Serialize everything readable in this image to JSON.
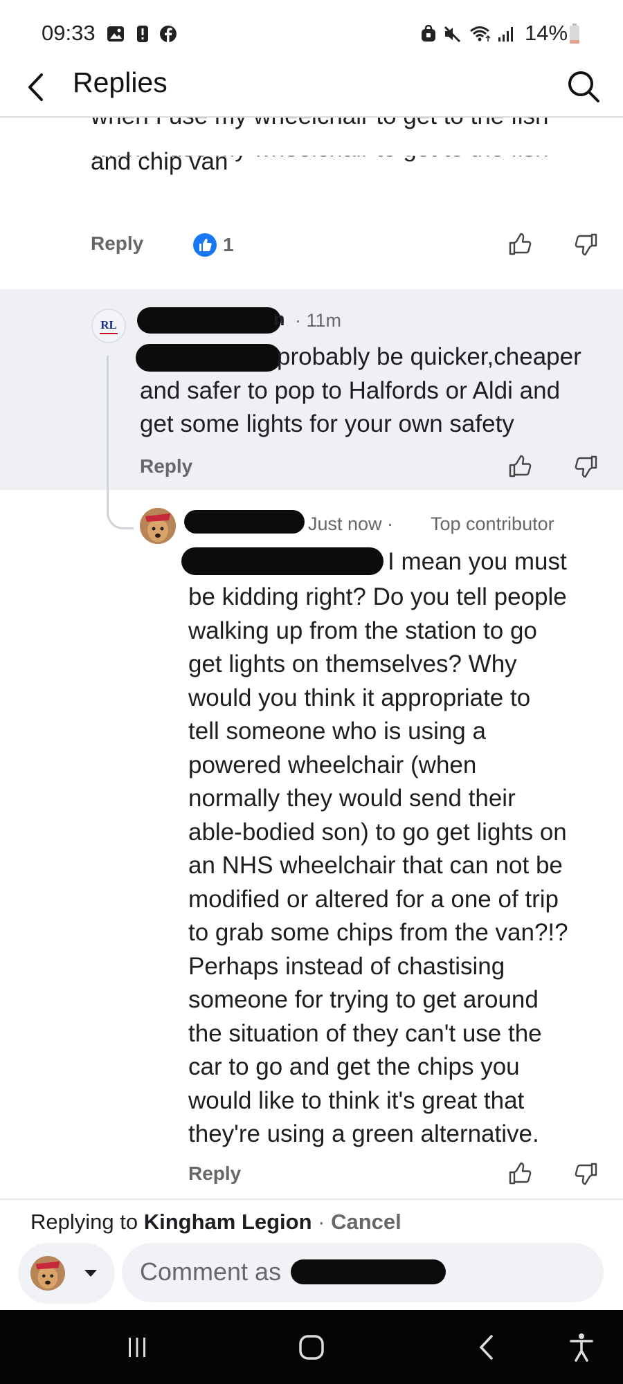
{
  "status": {
    "time": "09:33",
    "battery": "14%"
  },
  "header": {
    "title": "Replies"
  },
  "parent_comment": {
    "text_lines": [
      "when I use my wheelchair to get to the fish",
      "and chip van"
    ],
    "reply_label": "Reply",
    "like_count": "1"
  },
  "reply1": {
    "name_suffix": "n",
    "time": "· 11m",
    "text_first": "probably be quicker,cheaper",
    "text_lines": [
      "and safer to pop to Halfords or Aldi and",
      "get some lights for your own safety"
    ],
    "reply_label": "Reply",
    "avatar_text": "RL"
  },
  "reply2": {
    "time": "Just now ·",
    "badge": "Top contributor",
    "text_first": "I mean you must",
    "text_lines": [
      "be kidding right? Do you tell people",
      "walking up from the station to go",
      "get lights on themselves? Why",
      "would you think it appropriate to",
      "tell someone who is using a",
      "powered wheelchair (when",
      "normally they would send their",
      "able-bodied son) to go get lights on",
      "an NHS wheelchair that can not be",
      "modified or altered for a one of trip",
      "to grab some chips from the van?!?",
      "Perhaps instead of chastising",
      "someone for trying to get around",
      "the situation of they can't use the",
      "car to go and get the chips you",
      "would like to think it's great that",
      "they're using a green alternative."
    ],
    "reply_label": "Reply"
  },
  "composer": {
    "replying_prefix": "Replying to",
    "replying_name": "Kingham Legion",
    "separator": " · ",
    "cancel_label": "Cancel",
    "placeholder": "Comment as"
  },
  "colors": {
    "like_blue": "#1877f2",
    "meta_gray": "#65676b",
    "highlight_bg": "#eef0f4"
  }
}
